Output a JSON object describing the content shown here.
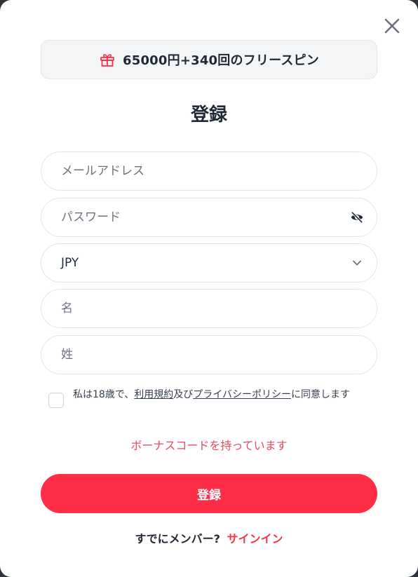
{
  "modal": {
    "bonus_text": "65000円+340回のフリースピン",
    "title": "登録"
  },
  "form": {
    "email_placeholder": "メールアドレス",
    "password_placeholder": "パスワード",
    "currency_value": "JPY",
    "first_name_placeholder": "名",
    "last_name_placeholder": "姓"
  },
  "consent": {
    "prefix": "私は18歳で、",
    "terms_link": "利用規約",
    "and": "及び",
    "privacy_link": "プライバシーポリシー",
    "suffix": "に同意します"
  },
  "promo_code_link": "ボーナスコードを持っています",
  "submit_label": "登録",
  "footer": {
    "prompt": "すでにメンバー?",
    "signin_link": "サインイン"
  },
  "colors": {
    "accent": "#ff2d46",
    "promo_link": "#e64b5d",
    "text": "#1f2937"
  }
}
